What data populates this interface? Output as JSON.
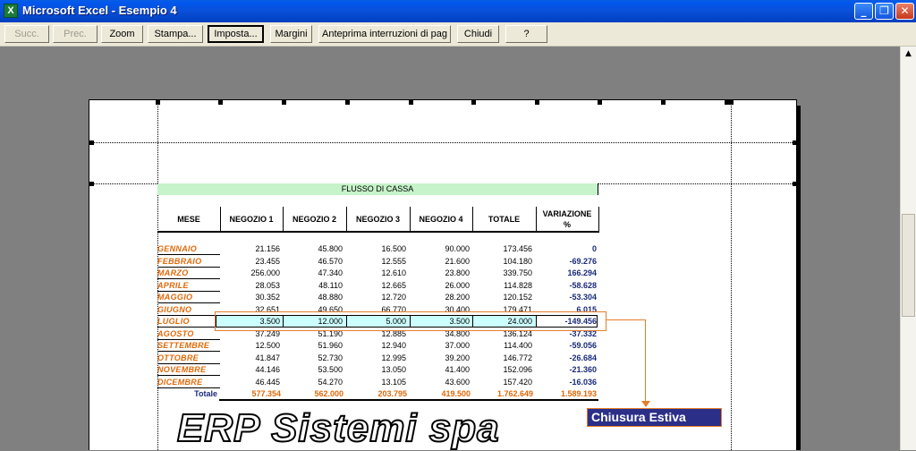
{
  "window": {
    "title": "Microsoft Excel - Esempio 4",
    "icon": "excel-app-icon",
    "controls": [
      "minimize-icon",
      "restore-icon",
      "close-icon"
    ]
  },
  "toolbar": {
    "succ": "Succ.",
    "prec": "Prec.",
    "zoom": "Zoom",
    "stampa": "Stampa...",
    "imposta": "Imposta...",
    "margini": "Margini",
    "anteprima": "Anteprima interruzioni di pag",
    "chiudi": "Chiudi",
    "help": "?"
  },
  "sheet": {
    "banner": "FLUSSO DI CASSA",
    "headers": [
      "MESE",
      "NEGOZIO 1",
      "NEGOZIO 2",
      "NEGOZIO 3",
      "NEGOZIO 4",
      "TOTALE",
      "VARIAZIONE\n%"
    ],
    "rows": [
      {
        "mese": "GENNAIO",
        "n1": "21.156",
        "n2": "45.800",
        "n3": "16.500",
        "n4": "90.000",
        "tot": "173.456",
        "var": "0"
      },
      {
        "mese": "FEBBRAIO",
        "n1": "23.455",
        "n2": "46.570",
        "n3": "12.555",
        "n4": "21.600",
        "tot": "104.180",
        "var": "-69.276"
      },
      {
        "mese": "MARZO",
        "n1": "256.000",
        "n2": "47.340",
        "n3": "12.610",
        "n4": "23.800",
        "tot": "339.750",
        "var": "166.294"
      },
      {
        "mese": "APRILE",
        "n1": "28.053",
        "n2": "48.110",
        "n3": "12.665",
        "n4": "26.000",
        "tot": "114.828",
        "var": "-58.628"
      },
      {
        "mese": "MAGGIO",
        "n1": "30.352",
        "n2": "48.880",
        "n3": "12.720",
        "n4": "28.200",
        "tot": "120.152",
        "var": "-53.304"
      },
      {
        "mese": "GIUGNO",
        "n1": "32.651",
        "n2": "49.650",
        "n3": "66.770",
        "n4": "30.400",
        "tot": "179.471",
        "var": "6.015"
      },
      {
        "mese": "LUGLIO",
        "n1": "3.500",
        "n2": "12.000",
        "n3": "5.000",
        "n4": "3.500",
        "tot": "24.000",
        "var": "-149.456"
      },
      {
        "mese": "AGOSTO",
        "n1": "37.249",
        "n2": "51.190",
        "n3": "12.885",
        "n4": "34.800",
        "tot": "136.124",
        "var": "-37.332"
      },
      {
        "mese": "SETTEMBRE",
        "n1": "12.500",
        "n2": "51.960",
        "n3": "12.940",
        "n4": "37.000",
        "tot": "114.400",
        "var": "-59.056"
      },
      {
        "mese": "OTTOBRE",
        "n1": "41.847",
        "n2": "52.730",
        "n3": "12.995",
        "n4": "39.200",
        "tot": "146.772",
        "var": "-26.684"
      },
      {
        "mese": "NOVEMBRE",
        "n1": "44.146",
        "n2": "53.500",
        "n3": "13.050",
        "n4": "41.400",
        "tot": "152.096",
        "var": "-21.360"
      },
      {
        "mese": "DICEMBRE",
        "n1": "46.445",
        "n2": "54.270",
        "n3": "13.105",
        "n4": "43.600",
        "tot": "157.420",
        "var": "-16.036"
      }
    ],
    "totals": {
      "label": "Totale",
      "n1": "577.354",
      "n2": "562.000",
      "n3": "203.795",
      "n4": "419.500",
      "tot": "1.762.649",
      "var": "1.589.193"
    }
  },
  "annotation": {
    "label": "Chiusura Estiva"
  },
  "logo": {
    "text": "ERP Sistemi spa"
  },
  "colors": {
    "titlebar": "#0058ee",
    "banner": "#c6f3c9",
    "month_text": "#e0690a",
    "variation_text": "#1a2a7a",
    "highlight": "#ccffff",
    "callout": "#e47e2a",
    "label_bg": "#2c2f88"
  }
}
